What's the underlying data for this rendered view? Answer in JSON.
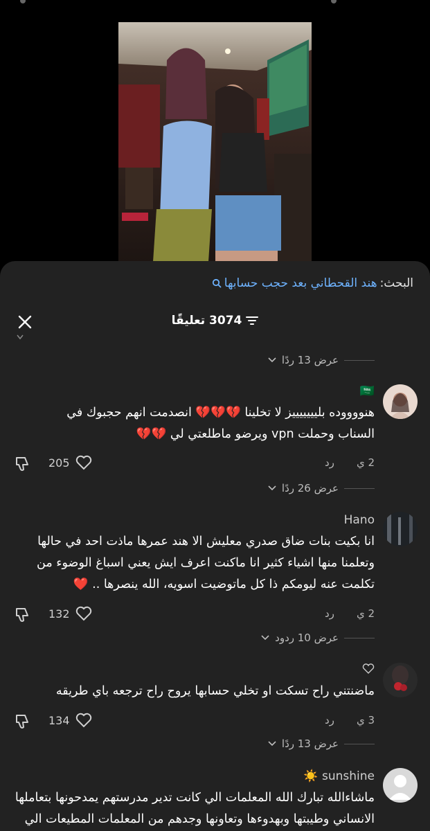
{
  "video": {
    "description_colors": {
      "bg": "#3a2c28"
    }
  },
  "sheet": {
    "search_prefix": "البحث:",
    "search_query": "هند القحطاني بعد حجب حسابها",
    "comments_count": "3074 تعليقًا",
    "close_icon": "close-icon",
    "filter_icon": "filter-icon"
  },
  "replies": [
    {
      "label": "عرض 13 ردًا"
    },
    {
      "label": "عرض 26 ردًا"
    },
    {
      "label": "عرض 10 ردود"
    },
    {
      "label": "عرض 13 ردًا"
    }
  ],
  "comments": [
    {
      "name": "🇸🇦",
      "line1": "هنووووده بليييييييز لا تخلينا 💔💔💔 انصدمت انهم حجبوك في",
      "line2": "السناب وحملت vpn ويرضو ماطلعتي لي 💔💔",
      "time": "2 ي",
      "reply": "رد",
      "likes": "205"
    },
    {
      "name": "Hano",
      "line1": "انا بكيت بنات ضاق صدري معليش الا هند عمرها ماذت احد في حالها",
      "line2": "وتعلمنا منها اشياء كثير انا ماكنت اعرف ايش يعني اسباغ الوضوء من",
      "line3": "تكلمت عنه ليومكم ذا كل ماتوضيت اسويه، الله ينصرها .. ❤️",
      "time": "2 ي",
      "reply": "رد",
      "likes": "132"
    },
    {
      "name": "",
      "line1": "ماضنتني راح تسكت او تخلي حسابها يروح راح ترجعه باي طريقه",
      "time": "3 ي",
      "reply": "رد",
      "likes": "134"
    },
    {
      "name": "sunshine ☀️",
      "line1": "ماشاءالله تبارك الله المعلمات الي كانت تدير مدرستهم يمدحونها بتعاملها",
      "line2": "الانساني وطيبتها وبهدوءها وتعاونها وجدهم من المعلمات المطيعات الي"
    }
  ]
}
